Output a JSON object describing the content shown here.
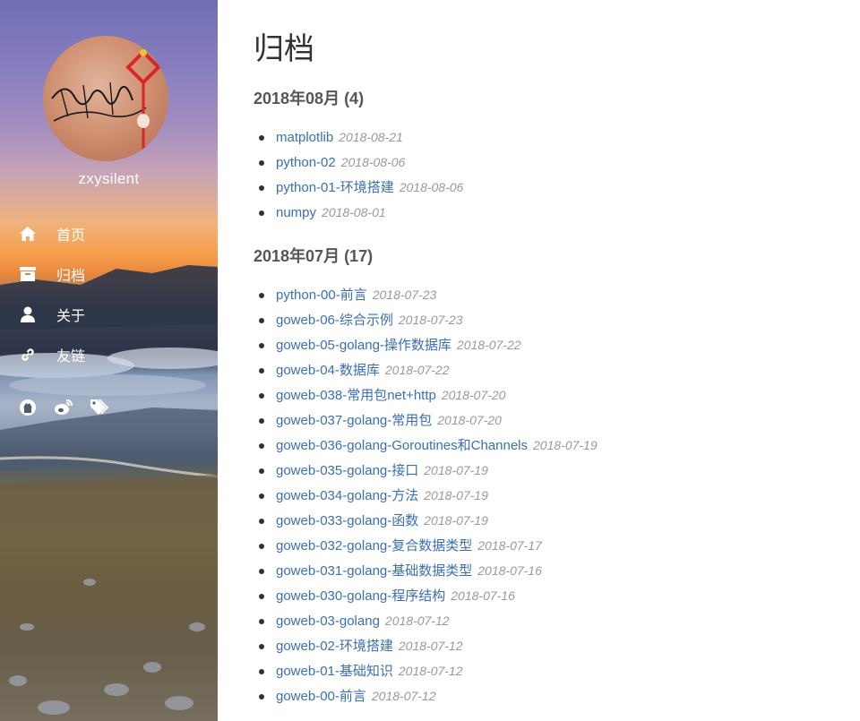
{
  "sidebar": {
    "username": "zxysilent",
    "nav": [
      {
        "label": "首页",
        "icon": "home-icon"
      },
      {
        "label": "归档",
        "icon": "archive-icon"
      },
      {
        "label": "关于",
        "icon": "user-icon"
      },
      {
        "label": "友链",
        "icon": "link-icon"
      }
    ],
    "social": [
      {
        "icon": "github-icon"
      },
      {
        "icon": "weibo-icon"
      },
      {
        "icon": "tags-icon"
      }
    ]
  },
  "main": {
    "title": "归档",
    "groups": [
      {
        "heading": "2018年08月 (4)",
        "posts": [
          {
            "title": "matplotlib",
            "date": "2018-08-21"
          },
          {
            "title": "python-02",
            "date": "2018-08-06"
          },
          {
            "title": "python-01-环境搭建",
            "date": "2018-08-06"
          },
          {
            "title": "numpy",
            "date": "2018-08-01"
          }
        ]
      },
      {
        "heading": "2018年07月 (17)",
        "posts": [
          {
            "title": "python-00-前言",
            "date": "2018-07-23"
          },
          {
            "title": "goweb-06-综合示例",
            "date": "2018-07-23"
          },
          {
            "title": "goweb-05-golang-操作数据库",
            "date": "2018-07-22"
          },
          {
            "title": "goweb-04-数据库",
            "date": "2018-07-22"
          },
          {
            "title": "goweb-038-常用包net+http",
            "date": "2018-07-20"
          },
          {
            "title": "goweb-037-golang-常用包",
            "date": "2018-07-20"
          },
          {
            "title": "goweb-036-golang-Goroutines和Channels",
            "date": "2018-07-19"
          },
          {
            "title": "goweb-035-golang-接口",
            "date": "2018-07-19"
          },
          {
            "title": "goweb-034-golang-方法",
            "date": "2018-07-19"
          },
          {
            "title": "goweb-033-golang-函数",
            "date": "2018-07-19"
          },
          {
            "title": "goweb-032-golang-复合数据类型",
            "date": "2018-07-17"
          },
          {
            "title": "goweb-031-golang-基础数据类型",
            "date": "2018-07-16"
          },
          {
            "title": "goweb-030-golang-程序结构",
            "date": "2018-07-16"
          },
          {
            "title": "goweb-03-golang",
            "date": "2018-07-12"
          },
          {
            "title": "goweb-02-环境搭建",
            "date": "2018-07-12"
          },
          {
            "title": "goweb-01-基础知识",
            "date": "2018-07-12"
          },
          {
            "title": "goweb-00-前言",
            "date": "2018-07-12"
          }
        ]
      }
    ]
  }
}
